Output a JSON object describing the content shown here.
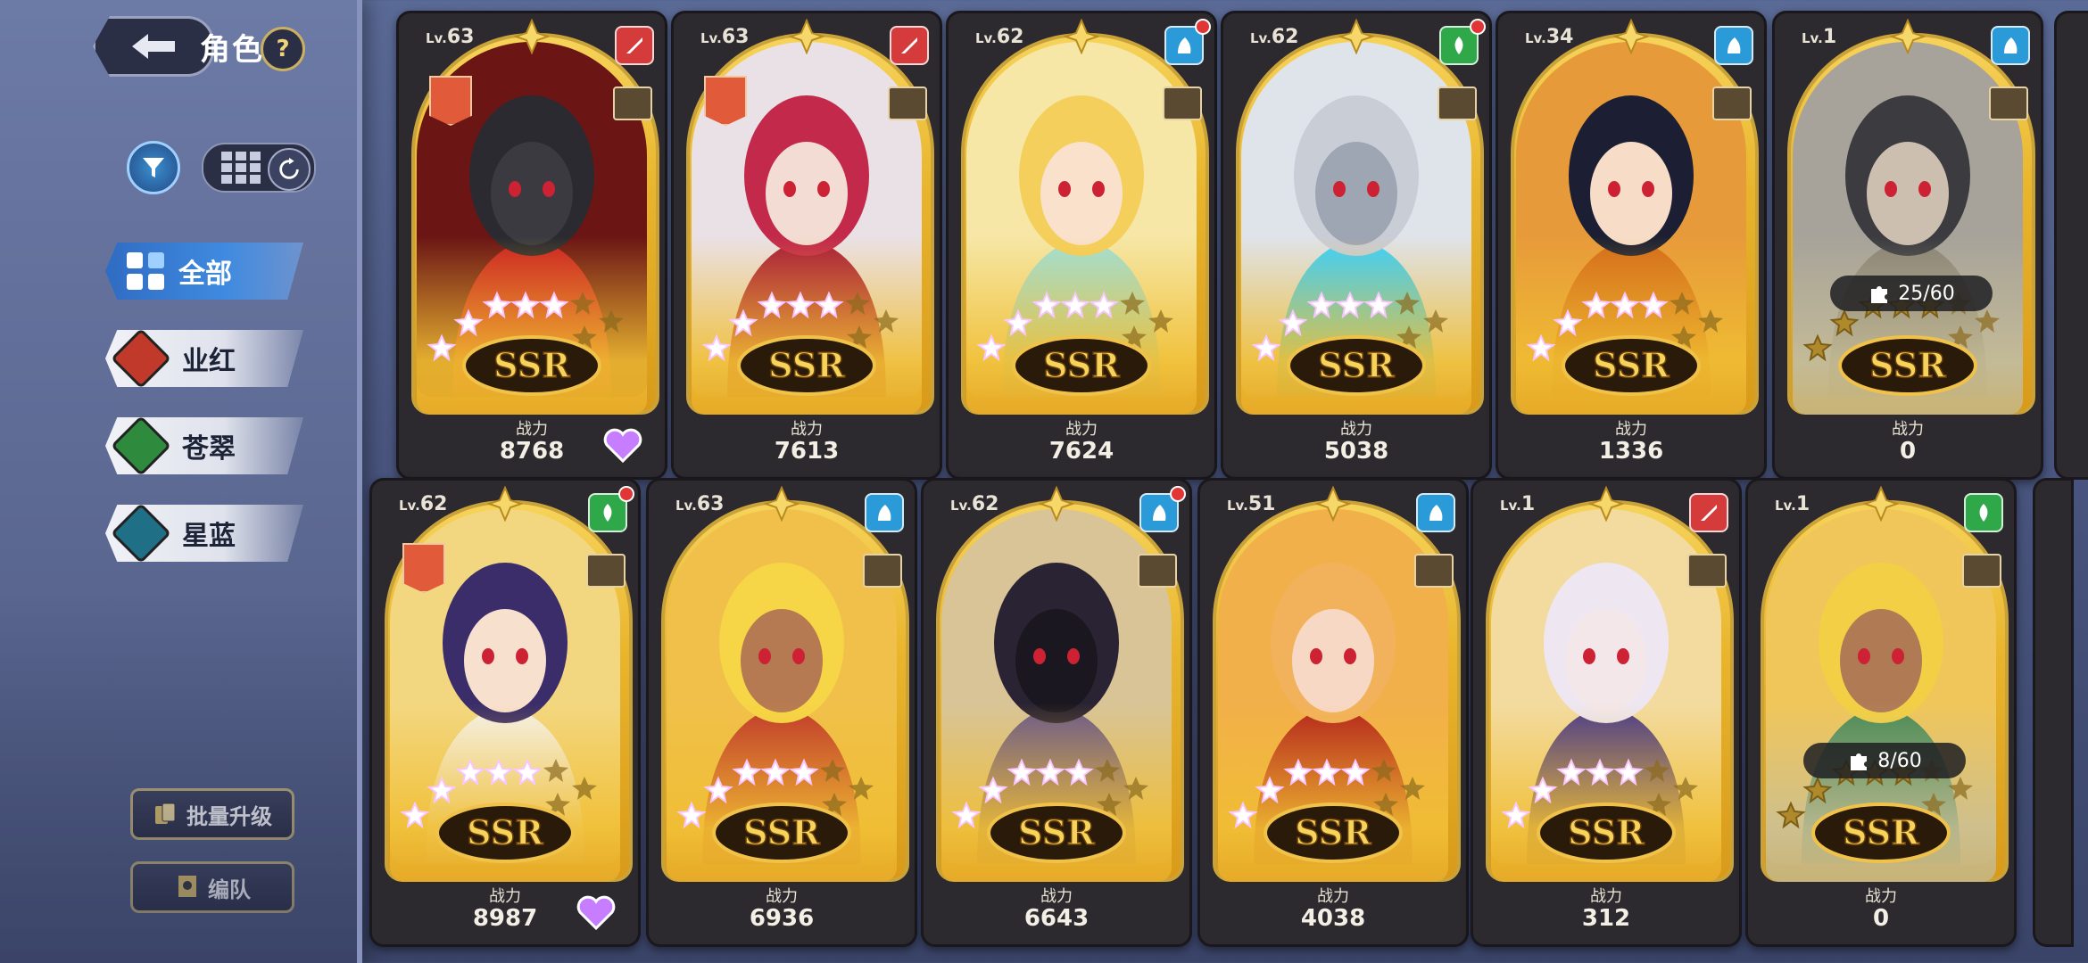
{
  "header": {
    "title": "角色",
    "help": "?"
  },
  "categories": [
    {
      "label": "全部",
      "active": true,
      "color": "#3f8ae0"
    },
    {
      "label": "业红",
      "active": false,
      "color": "#c0392b"
    },
    {
      "label": "苍翠",
      "active": false,
      "color": "#2e8b3e"
    },
    {
      "label": "星蓝",
      "active": false,
      "color": "#1f6f86"
    }
  ],
  "bottom_buttons": {
    "batch_upgrade": "批量升级",
    "team": "编队"
  },
  "power_label": "战力",
  "rarity": "SSR",
  "cards": [
    {
      "lv": "63",
      "power": "8768",
      "element": "red",
      "elem_color": "#d63b3b",
      "badge": true,
      "heart": true,
      "dot": false,
      "portrait": "dark-knight"
    },
    {
      "lv": "63",
      "power": "7613",
      "element": "red",
      "elem_color": "#d63b3b",
      "badge": true,
      "heart": false,
      "dot": false,
      "portrait": "crimson-armor"
    },
    {
      "lv": "62",
      "power": "7624",
      "element": "blue",
      "elem_color": "#2a9bd8",
      "badge": false,
      "heart": false,
      "dot": true,
      "portrait": "blonde-girl"
    },
    {
      "lv": "62",
      "power": "5038",
      "element": "green",
      "elem_color": "#2fa84a",
      "badge": false,
      "heart": false,
      "dot": true,
      "portrait": "white-knight"
    },
    {
      "lv": "34",
      "power": "1336",
      "element": "blue",
      "elem_color": "#2a9bd8",
      "badge": false,
      "heart": false,
      "dot": false,
      "portrait": "dark-hair-girl"
    },
    {
      "lv": "1",
      "power": "0",
      "element": "blue",
      "elem_color": "#2a9bd8",
      "badge": false,
      "heart": false,
      "dot": false,
      "portrait": "grey-warrior",
      "shards": "25/60"
    },
    {
      "lv": "62",
      "power": "8987",
      "element": "green",
      "elem_color": "#2fa84a",
      "badge": true,
      "heart": true,
      "dot": true,
      "portrait": "horned-lady"
    },
    {
      "lv": "63",
      "power": "6936",
      "element": "blue",
      "elem_color": "#2a9bd8",
      "badge": false,
      "heart": false,
      "dot": false,
      "portrait": "elf-boy"
    },
    {
      "lv": "62",
      "power": "6643",
      "element": "blue",
      "elem_color": "#2a9bd8",
      "badge": false,
      "heart": false,
      "dot": true,
      "portrait": "dark-helm"
    },
    {
      "lv": "51",
      "power": "4038",
      "element": "blue",
      "elem_color": "#2a9bd8",
      "badge": false,
      "heart": false,
      "dot": false,
      "portrait": "red-hood"
    },
    {
      "lv": "1",
      "power": "312",
      "element": "red",
      "elem_color": "#d63b3b",
      "badge": false,
      "heart": false,
      "dot": false,
      "portrait": "pale-vampire"
    },
    {
      "lv": "1",
      "power": "0",
      "element": "green",
      "elem_color": "#2fa84a",
      "badge": false,
      "heart": false,
      "dot": false,
      "portrait": "elf-girl",
      "shards": "8/60"
    }
  ]
}
